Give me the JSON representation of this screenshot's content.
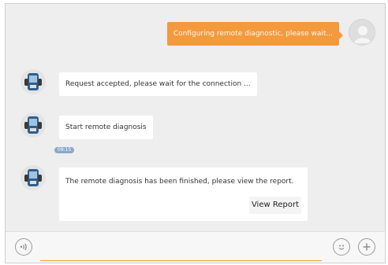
{
  "messages": {
    "outgoing_1": "Configuring remote diagnostic, please wait...",
    "incoming_1": "Request accepted, please wait for the connection ...",
    "incoming_2": "Start remote diagnosis",
    "timestamp": "09:15",
    "incoming_3": "The remote diagnosis has been finished, please view the report.",
    "view_report_label": "View Report"
  },
  "input_bar": {
    "text_value": "",
    "voice_icon": "voice-icon",
    "emoji_icon": "smiley-icon",
    "add_icon": "plus-icon"
  },
  "colors": {
    "accent": "#f39a3e",
    "background": "#eeeeee",
    "bubble": "#ffffff",
    "timestamp_badge": "#8aa9c8"
  }
}
